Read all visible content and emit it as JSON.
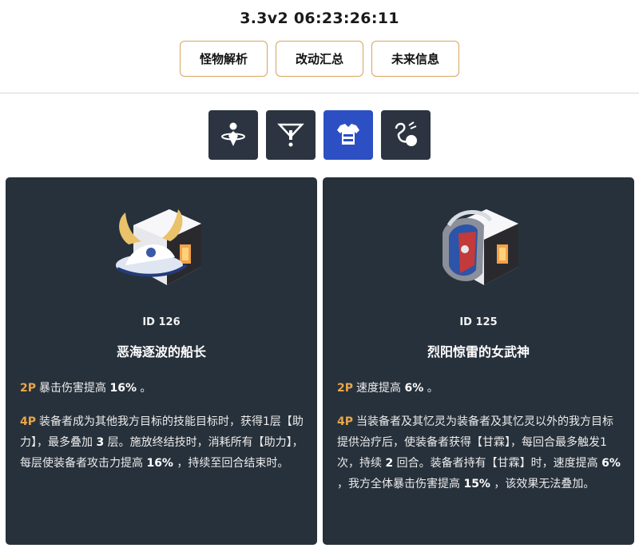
{
  "header": {
    "version": "3.3v2 06:23:26:11"
  },
  "nav": [
    {
      "label": "怪物解析"
    },
    {
      "label": "改动汇总"
    },
    {
      "label": "未来信息"
    }
  ],
  "path_tabs": [
    {
      "icon": "remembrance-path-icon",
      "active": false
    },
    {
      "icon": "nihility-path-icon",
      "active": false
    },
    {
      "icon": "preservation-path-icon",
      "active": true
    },
    {
      "icon": "harmony-path-icon",
      "active": false
    }
  ],
  "colors": {
    "accent_border": "#d9a35e",
    "card_bg": "#27313b",
    "active_tab": "#2d4fc4",
    "tag_color": "#e8a54b"
  },
  "relics": [
    {
      "id_text": "ID 126",
      "name": "恶海逐波的船长",
      "effect_2p_tag": "2P",
      "effect_2p": [
        "暴击伤害提高 ",
        "16%",
        " 。"
      ],
      "effect_4p_tag": "4P",
      "effect_4p": [
        "装备者成为其他我方目标的技能目标时，获得1层【助力】，最多叠加 ",
        "3",
        " 层。施放终结技时，消耗所有【助力】，每层使装备者攻击力提高 ",
        "16%",
        " ，持续至回合结束时。"
      ]
    },
    {
      "id_text": "ID 125",
      "name": "烈阳惊雷的女武神",
      "effect_2p_tag": "2P",
      "effect_2p": [
        "速度提高 ",
        "6%",
        " 。"
      ],
      "effect_4p_tag": "4P",
      "effect_4p": [
        "当装备者及其忆灵为装备者及其忆灵以外的我方目标提供治疗后，使装备者获得【甘霖】，每回合最多触发1次，持续 ",
        "2",
        " 回合。装备者持有【甘霖】时，速度提高 ",
        "6%",
        " ，我方全体暴击伤害提高 ",
        "15%",
        " ，该效果无法叠加。"
      ]
    }
  ]
}
